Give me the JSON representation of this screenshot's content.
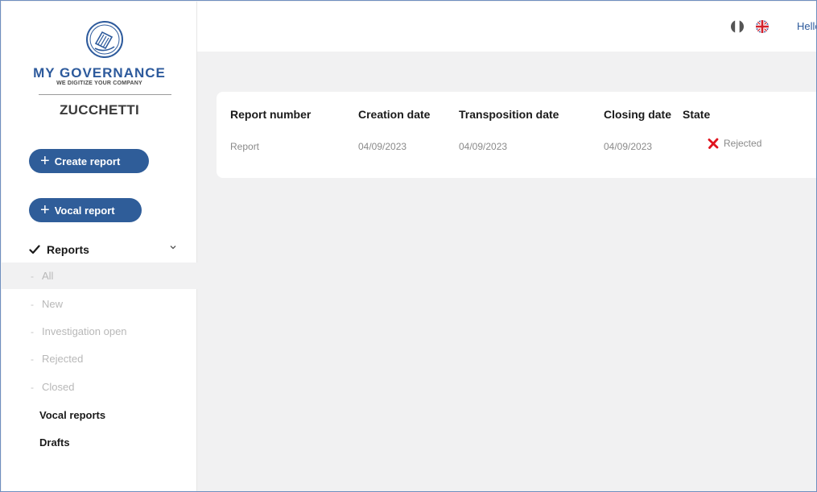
{
  "brand": {
    "name": "MY GOVERNANCE",
    "tagline": "WE DIGITIZE YOUR COMPANY",
    "company": "ZUCCHETTI",
    "logo_icon": "book-emblem-icon"
  },
  "sidebar": {
    "create_report_label": "Create report",
    "vocal_report_label": "Vocal report",
    "reports_section": {
      "label": "Reports",
      "items": [
        {
          "label": "All",
          "active": true
        },
        {
          "label": "New",
          "active": false
        },
        {
          "label": "Investigation open",
          "active": false
        },
        {
          "label": "Rejected",
          "active": false
        },
        {
          "label": "Closed",
          "active": false
        }
      ]
    },
    "vocal_reports_label": "Vocal reports",
    "drafts_label": "Drafts"
  },
  "header": {
    "languages": [
      "italian-flag-icon",
      "uk-flag-icon"
    ],
    "greeting": "Hello"
  },
  "table": {
    "columns": [
      "Report number",
      "Creation date",
      "Transposition date",
      "Closing date",
      "State"
    ],
    "rows": [
      {
        "report_number": "Report",
        "creation_date": "04/09/2023",
        "transposition_date": "04/09/2023",
        "closing_date": "04/09/2023",
        "state": "Rejected",
        "state_icon": "red-x-icon"
      }
    ]
  },
  "colors": {
    "primary": "#2f5d99",
    "brand_text": "#2d5a9c",
    "background": "#f1f1f2",
    "rejected_icon": "#e0141e",
    "muted_text": "#8a8a8a"
  }
}
